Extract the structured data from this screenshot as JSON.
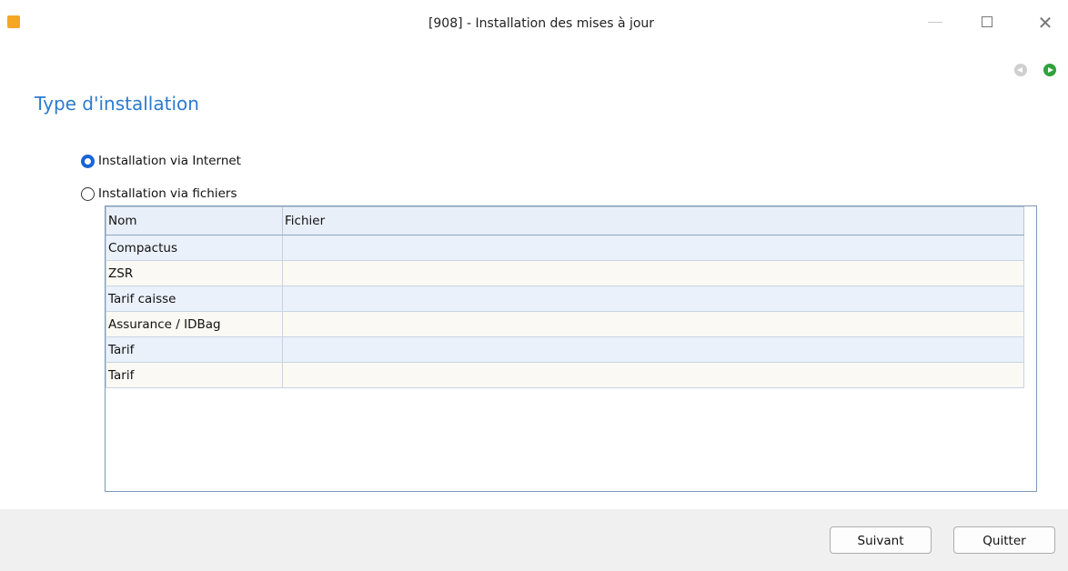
{
  "window": {
    "title": "[908] - Installation des mises à jour",
    "close_glyph": "✕"
  },
  "icons": {
    "app": "app-logo-icon",
    "back": "back-arrow-icon",
    "forward": "forward-arrow-icon"
  },
  "page": {
    "title": "Type d'installation"
  },
  "options": {
    "internet": {
      "label": "Installation via Internet",
      "selected": true
    },
    "files": {
      "label": "Installation via fichiers",
      "selected": false
    }
  },
  "grid": {
    "headers": [
      "Nom",
      "Fichier"
    ],
    "rows": [
      [
        "Compactus",
        ""
      ],
      [
        "ZSR",
        ""
      ],
      [
        "Tarif caisse",
        ""
      ],
      [
        "Assurance / IDBag",
        ""
      ],
      [
        "Tarif",
        ""
      ],
      [
        "Tarif",
        ""
      ]
    ]
  },
  "buttons": {
    "next": "Suivant",
    "quit": "Quitter"
  },
  "colors": {
    "title_blue": "#2b7bd1",
    "radio_blue": "#1864d6",
    "forward_green": "#2fa33a"
  }
}
